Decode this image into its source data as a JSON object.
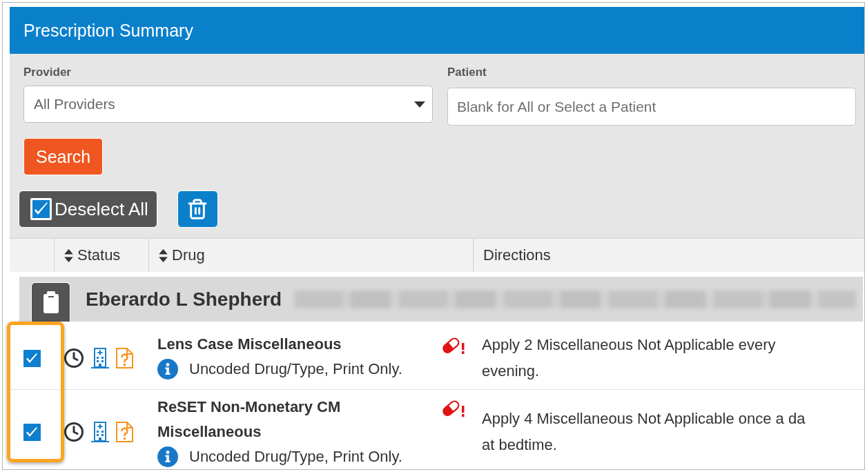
{
  "panel": {
    "title": "Prescription Summary"
  },
  "filters": {
    "provider": {
      "label": "Provider",
      "value": "All Providers"
    },
    "patient": {
      "label": "Patient",
      "placeholder": "Blank for All or Select a Patient"
    },
    "search_button": {
      "label": "Search"
    }
  },
  "toolbar": {
    "deselect_all": {
      "label": "Deselect All"
    }
  },
  "table": {
    "columns": [
      {
        "label": "Status",
        "sortable": true
      },
      {
        "label": "Drug",
        "sortable": true
      },
      {
        "label": "Directions",
        "sortable": false
      }
    ],
    "groups": [
      {
        "patient": "Eberardo L Shepherd",
        "rows": [
          {
            "checked": true,
            "drug": "Lens Case Miscellaneous",
            "note": "Uncoded Drug/Type, Print Only.",
            "directions": "Apply 2 Miscellaneous Not Applicable every\nevening."
          },
          {
            "checked": true,
            "drug": "ReSET Non-Monetary CM Miscellaneous",
            "note": "Uncoded Drug/Type, Print Only.",
            "directions": "Apply 4 Miscellaneous Not Applicable once a da\nat bedtime."
          }
        ]
      }
    ]
  }
}
